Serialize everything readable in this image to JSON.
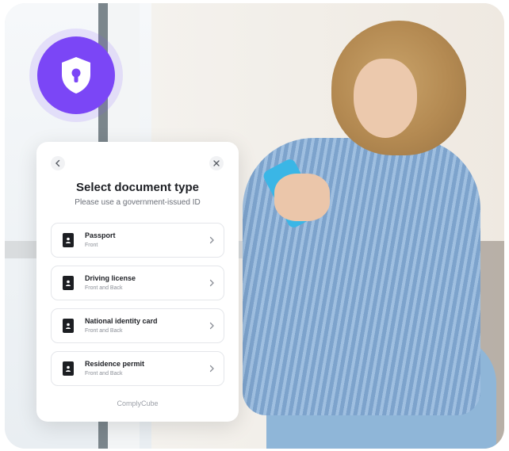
{
  "modal": {
    "title": "Select document type",
    "subtitle": "Please use a government-issued ID",
    "footer_brand": "ComplyCube"
  },
  "documents": [
    {
      "label": "Passport",
      "sides": "Front"
    },
    {
      "label": "Driving license",
      "sides": "Front and Back"
    },
    {
      "label": "National identity card",
      "sides": "Front and Back"
    },
    {
      "label": "Residence permit",
      "sides": "Front and Back"
    }
  ],
  "icons": {
    "badge": "shield-lock-icon",
    "back": "chevron-left-icon",
    "close": "close-icon",
    "document": "id-document-icon",
    "row_arrow": "chevron-right-icon"
  },
  "colors": {
    "accent": "#7b46f6",
    "card": "#ffffff",
    "text": "#1d1f24"
  }
}
